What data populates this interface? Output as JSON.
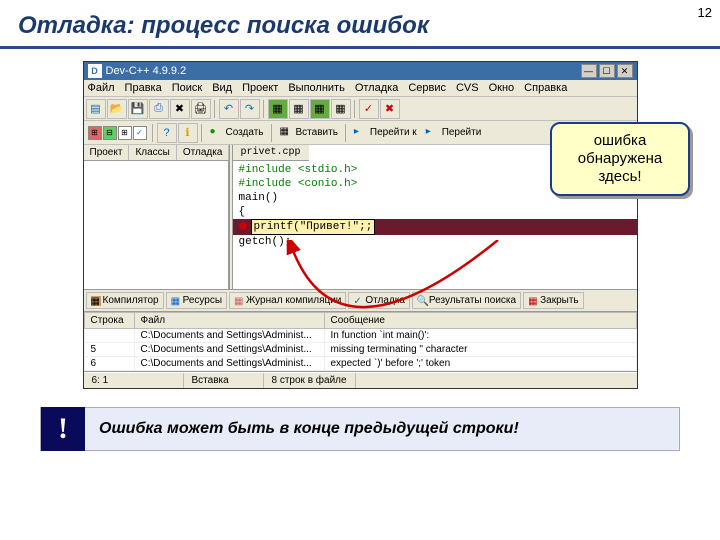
{
  "page_number": "12",
  "slide_title": "Отладка: процесс поиска ошибок",
  "ide": {
    "title": "Dev-C++ 4.9.9.2",
    "menu": [
      "Файл",
      "Правка",
      "Поиск",
      "Вид",
      "Проект",
      "Выполнить",
      "Отладка",
      "Сервис",
      "CVS",
      "Окно",
      "Справка"
    ],
    "toolbar_labels": {
      "create": "Создать",
      "insert": "Вставить",
      "goto": "Перейти к",
      "goto2": "Перейти"
    },
    "left_tabs": [
      "Проект",
      "Классы",
      "Отладка"
    ],
    "code_tab": "privet.cpp",
    "code": {
      "l1": "#include <stdio.h>",
      "l2": "#include <conio.h>",
      "l3": "main()",
      "l4": "{",
      "l5": "printf(\"Привет!\";;",
      "l6": "getch();"
    },
    "bottom_tabs": [
      "Компилятор",
      "Ресурсы",
      "Журнал компиляции",
      "Отладка",
      "Результаты поиска",
      "Закрыть"
    ],
    "err_headers": {
      "line": "Строка",
      "file": "Файл",
      "msg": "Сообщение"
    },
    "errors": [
      {
        "line": "",
        "file": "C:\\Documents and Settings\\Administ...",
        "msg": "In function `int main()':"
      },
      {
        "line": "5",
        "file": "C:\\Documents and Settings\\Administ...",
        "msg": "missing terminating \" character"
      },
      {
        "line": "6",
        "file": "C:\\Documents and Settings\\Administ...",
        "msg": "expected `)' before ';' token"
      }
    ],
    "status": {
      "pos": "6: 1",
      "mode": "Вставка",
      "lines": "8 строк в файле"
    }
  },
  "callout": "ошибка обнаружена здесь!",
  "warning": "Ошибка может быть в конце предыдущей строки!"
}
